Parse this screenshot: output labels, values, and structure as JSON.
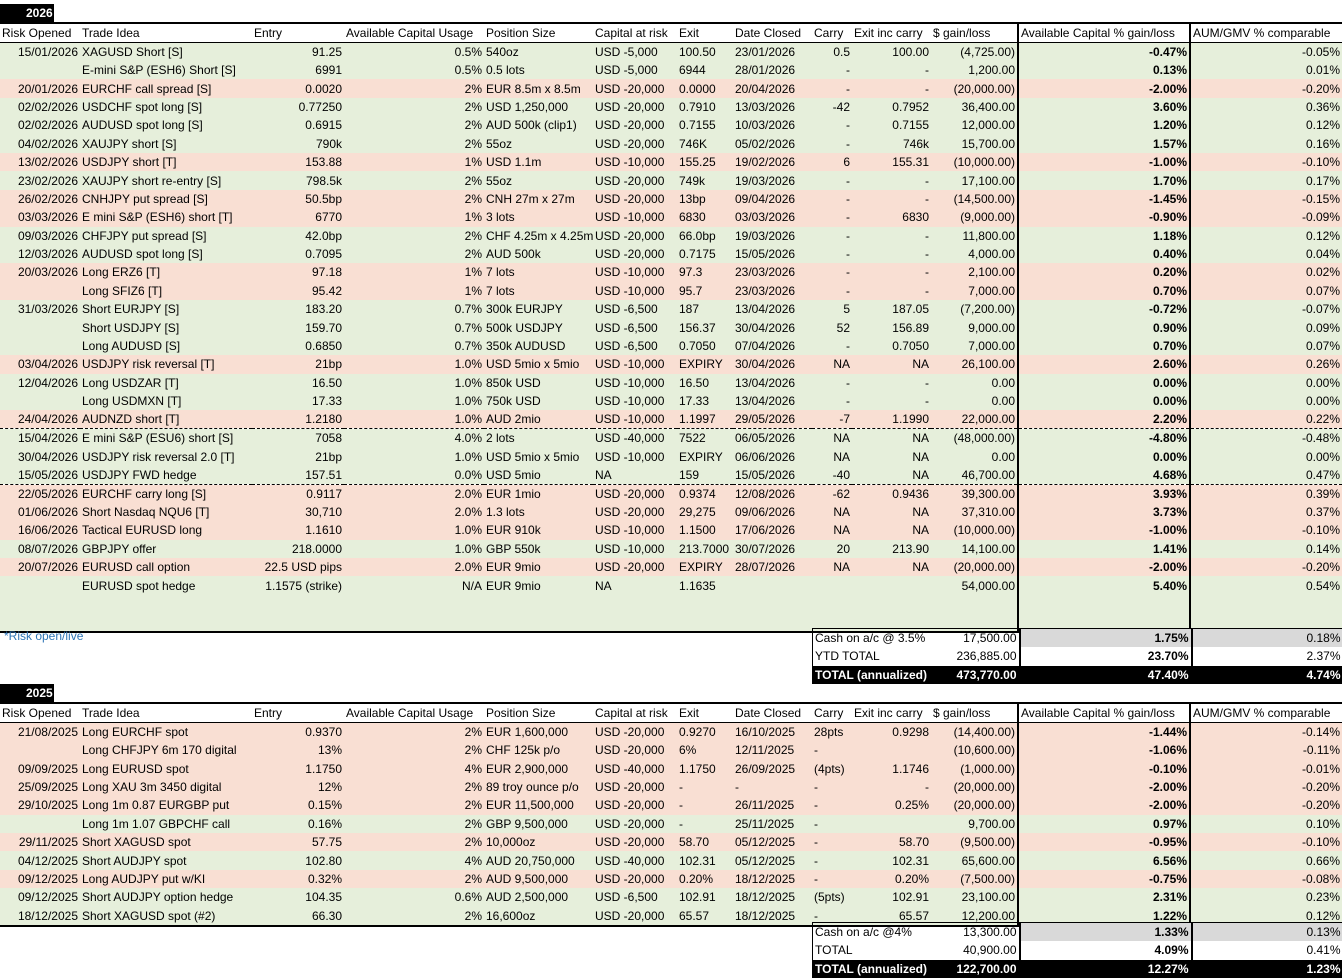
{
  "headers": [
    "Risk Opened",
    "Trade Idea",
    "Entry",
    "Available Capital Usage",
    "Position Size",
    "Capital at risk",
    "Exit",
    "Date Closed",
    "Carry",
    "Exit inc carry",
    "$ gain/loss",
    "Available Capital % gain/loss",
    "AUM/GMV % comparable"
  ],
  "y2026": {
    "label": "2026",
    "rows": [
      {
        "c": "g",
        "d": [
          "15/01/2026",
          "XAGUSD Short [S]",
          "91.25",
          "0.5%",
          "540oz",
          "USD -5,000",
          "100.50",
          "23/01/2026",
          "0.5",
          "100.00",
          "(4,725.00)",
          "-0.47%",
          "-0.05%"
        ]
      },
      {
        "c": "g",
        "d": [
          "",
          "E-mini S&P (ESH6) Short [S]",
          "6991",
          "0.5%",
          "0.5 lots",
          "USD -5,000",
          "6944",
          "28/01/2026",
          "-",
          "-",
          "1,200.00",
          "0.13%",
          "0.01%"
        ]
      },
      {
        "c": "r",
        "d": [
          "20/01/2026",
          "EURCHF call spread [S]",
          "0.0020",
          "2%",
          "EUR 8.5m x 8.5m",
          "USD -20,000",
          "0.0000",
          "20/04/2026",
          "-",
          "-",
          "(20,000.00)",
          "-2.00%",
          "-0.20%"
        ]
      },
      {
        "c": "g",
        "d": [
          "02/02/2026",
          "USDCHF spot long [S]",
          "0.77250",
          "2%",
          "USD 1,250,000",
          "USD -20,000",
          "0.7910",
          "13/03/2026",
          "-42",
          "0.7952",
          "36,400.00",
          "3.60%",
          "0.36%"
        ]
      },
      {
        "c": "g",
        "d": [
          "02/02/2026",
          "AUDUSD spot long [S]",
          "0.6915",
          "2%",
          "AUD 500k (clip1)",
          "USD -20,000",
          "0.7155",
          "10/03/2026",
          "-",
          "0.7155",
          "12,000.00",
          "1.20%",
          "0.12%"
        ]
      },
      {
        "c": "g",
        "d": [
          "04/02/2026",
          "XAUJPY short [S]",
          "790k",
          "2%",
          "55oz",
          "USD -20,000",
          "746K",
          "05/02/2026",
          "-",
          "746k",
          "15,700.00",
          "1.57%",
          "0.16%"
        ]
      },
      {
        "c": "r",
        "d": [
          "13/02/2026",
          "USDJPY short [T]",
          "153.88",
          "1%",
          "USD 1.1m",
          "USD -10,000",
          "155.25",
          "19/02/2026",
          "6",
          "155.31",
          "(10,000.00)",
          "-1.00%",
          "-0.10%"
        ]
      },
      {
        "c": "g",
        "d": [
          "23/02/2026",
          "XAUJPY short re-entry [S]",
          "798.5k",
          "2%",
          "55oz",
          "USD -20,000",
          "749k",
          "19/03/2026",
          "-",
          "-",
          "17,100.00",
          "1.70%",
          "0.17%"
        ]
      },
      {
        "c": "r",
        "d": [
          "26/02/2026",
          "CNHJPY put spread [S]",
          "50.5bp",
          "2%",
          "CNH 27m x 27m",
          "USD -20,000",
          "13bp",
          "09/04/2026",
          "-",
          "-",
          "(14,500.00)",
          "-1.45%",
          "-0.15%"
        ]
      },
      {
        "c": "r",
        "d": [
          "03/03/2026",
          "E mini S&P (ESH6) short [T]",
          "6770",
          "1%",
          "3 lots",
          "USD -10,000",
          "6830",
          "03/03/2026",
          "-",
          "6830",
          "(9,000.00)",
          "-0.90%",
          "-0.09%"
        ]
      },
      {
        "c": "g",
        "d": [
          "09/03/2026",
          "CHFJPY put spread [S]",
          "42.0bp",
          "2%",
          "CHF 4.25m x 4.25m",
          "USD -20,000",
          "66.0bp",
          "19/03/2026",
          "-",
          "-",
          "11,800.00",
          "1.18%",
          "0.12%"
        ]
      },
      {
        "c": "g",
        "d": [
          "12/03/2026",
          "AUDUSD spot long [S]",
          "0.7095",
          "2%",
          "AUD 500k",
          "USD -20,000",
          "0.7175",
          "15/05/2026",
          "-",
          "-",
          "4,000.00",
          "0.40%",
          "0.04%"
        ]
      },
      {
        "c": "r",
        "d": [
          "20/03/2026",
          "Long ERZ6 [T]",
          "97.18",
          "1%",
          "7 lots",
          "USD -10,000",
          "97.3",
          "23/03/2026",
          "-",
          "-",
          "2,100.00",
          "0.20%",
          "0.02%"
        ]
      },
      {
        "c": "r",
        "d": [
          "",
          "Long SFIZ6 [T]",
          "95.42",
          "1%",
          "7 lots",
          "USD -10,000",
          "95.7",
          "23/03/2026",
          "-",
          "-",
          "7,000.00",
          "0.70%",
          "0.07%"
        ]
      },
      {
        "c": "g",
        "d": [
          "31/03/2026",
          "Short EURJPY [S]",
          "183.20",
          "0.7%",
          "300k EURJPY",
          "USD -6,500",
          "187",
          "13/04/2026",
          "5",
          "187.05",
          "(7,200.00)",
          "-0.72%",
          "-0.07%"
        ]
      },
      {
        "c": "g",
        "d": [
          "",
          "Short USDJPY [S]",
          "159.70",
          "0.7%",
          "500k USDJPY",
          "USD -6,500",
          "156.37",
          "30/04/2026",
          "52",
          "156.89",
          "9,000.00",
          "0.90%",
          "0.09%"
        ]
      },
      {
        "c": "g",
        "d": [
          "",
          "Long AUDUSD [S]",
          "0.6850",
          "0.7%",
          "350k AUDUSD",
          "USD -6,500",
          "0.7050",
          "07/04/2026",
          "-",
          "0.7050",
          "7,000.00",
          "0.70%",
          "0.07%"
        ]
      },
      {
        "c": "r",
        "d": [
          "03/04/2026",
          "USDJPY risk reversal [T]",
          "21bp",
          "1.0%",
          "USD 5mio x 5mio",
          "USD -10,000",
          "EXPIRY",
          "30/04/2026",
          "NA",
          "NA",
          "26,100.00",
          "2.60%",
          "0.26%"
        ]
      },
      {
        "c": "g",
        "d": [
          "12/04/2026",
          "Long USDZAR [T]",
          "16.50",
          "1.0%",
          "850k USD",
          "USD -10,000",
          "16.50",
          "13/04/2026",
          "-",
          "-",
          "0.00",
          "0.00%",
          "0.00%"
        ]
      },
      {
        "c": "g",
        "d": [
          "",
          "Long USDMXN [T]",
          "17.33",
          "1.0%",
          "750k USD",
          "USD -10,000",
          "17.33",
          "13/04/2026",
          "-",
          "-",
          "0.00",
          "0.00%",
          "0.00%"
        ]
      },
      {
        "c": "r",
        "d": [
          "24/04/2026",
          "AUDNZD short [T]",
          "1.2180",
          "1.0%",
          "AUD 2mio",
          "USD -10,000",
          "1.1997",
          "29/05/2026",
          "-7",
          "1.1990",
          "22,000.00",
          "2.20%",
          "0.22%"
        ]
      },
      {
        "c": "g",
        "sep": true,
        "d": [
          "15/04/2026",
          "E mini S&P (ESU6) short [S]",
          "7058",
          "4.0%",
          "2 lots",
          "USD -40,000",
          "7522",
          "06/05/2026",
          "NA",
          "NA",
          "(48,000.00)",
          "-4.80%",
          "-0.48%"
        ]
      },
      {
        "c": "g",
        "d": [
          "30/04/2026",
          "USDJPY risk reversal 2.0 [T]",
          "21bp",
          "1.0%",
          "USD 5mio x 5mio",
          "USD -10,000",
          "EXPIRY",
          "06/06/2026",
          "NA",
          "NA",
          "0.00",
          "0.00%",
          "0.00%"
        ]
      },
      {
        "c": "g",
        "d": [
          "15/05/2026",
          "USDJPY FWD hedge",
          "157.51",
          "0.0%",
          "USD 5mio",
          "NA",
          "159",
          "15/05/2026",
          "-40",
          "NA",
          "46,700.00",
          "4.68%",
          "0.47%"
        ]
      },
      {
        "c": "r",
        "sep": true,
        "d": [
          "22/05/2026",
          "EURCHF carry long [S]",
          "0.9117",
          "2.0%",
          "EUR 1mio",
          "USD -20,000",
          "0.9374",
          "12/08/2026",
          "-62",
          "0.9436",
          "39,300.00",
          "3.93%",
          "0.39%"
        ]
      },
      {
        "c": "r",
        "d": [
          "01/06/2026",
          "Short Nasdaq NQU6 [T]",
          "30,710",
          "2.0%",
          "1.3 lots",
          "USD -20,000",
          "29,275",
          "09/06/2026",
          "NA",
          "NA",
          "37,310.00",
          "3.73%",
          "0.37%"
        ]
      },
      {
        "c": "r",
        "d": [
          "16/06/2026",
          "Tactical EURUSD long",
          "1.1610",
          "1.0%",
          "EUR 910k",
          "USD -10,000",
          "1.1500",
          "17/06/2026",
          "NA",
          "NA",
          "(10,000.00)",
          "-1.00%",
          "-0.10%"
        ]
      },
      {
        "c": "g",
        "d": [
          "08/07/2026",
          "GBPJPY offer",
          "218.0000",
          "1.0%",
          "GBP 550k",
          "USD -10,000",
          "213.7000",
          "30/07/2026",
          "20",
          "213.90",
          "14,100.00",
          "1.41%",
          "0.14%"
        ]
      },
      {
        "c": "r",
        "d": [
          "20/07/2026",
          "EURUSD call option",
          "22.5 USD pips",
          "2.0%",
          "EUR 9mio",
          "USD -20,000",
          "EXPIRY",
          "28/07/2026",
          "NA",
          "NA",
          "(20,000.00)",
          "-2.00%",
          "-0.20%"
        ]
      },
      {
        "c": "g",
        "d": [
          "",
          "EURUSD spot hedge",
          "1.1575 (strike)",
          "N/A",
          "EUR 9mio",
          "NA",
          "1.1635",
          "",
          "",
          "",
          "54,000.00",
          "5.40%",
          "0.54%"
        ]
      }
    ],
    "note": "*Risk open/live",
    "summary": [
      {
        "label": "Cash on a/c @ 3.5%",
        "value": "17,500.00",
        "pct": "1.75%",
        "aum": "0.18%",
        "style": "gray"
      },
      {
        "label": "YTD TOTAL",
        "value": "236,885.00",
        "pct": "23.70%",
        "aum": "2.37%",
        "style": "plain"
      },
      {
        "label": "TOTAL (annualized)",
        "value": "473,770.00",
        "pct": "47.40%",
        "aum": "4.74%",
        "style": "black"
      }
    ]
  },
  "y2025": {
    "label": "2025",
    "rows": [
      {
        "c": "r",
        "d": [
          "21/08/2025",
          "Long EURCHF spot",
          "0.9370",
          "2%",
          "EUR 1,600,000",
          "USD -20,000",
          "0.9270",
          "16/10/2025",
          "28pts",
          "0.9298",
          "(14,400.00)",
          "-1.44%",
          "-0.14%"
        ]
      },
      {
        "c": "r",
        "d": [
          "",
          "Long CHFJPY 6m 170 digital",
          "13%",
          "2%",
          "CHF 125k p/o",
          "USD -20,000",
          "6%",
          "12/11/2025",
          "-",
          "",
          "(10,600.00)",
          "-1.06%",
          "-0.11%"
        ]
      },
      {
        "c": "r",
        "d": [
          "09/09/2025",
          "Long EURUSD spot",
          "1.1750",
          "4%",
          "EUR 2,900,000",
          "USD -40,000",
          "1.1750",
          "26/09/2025",
          "(4pts)",
          "1.1746",
          "(1,000.00)",
          "-0.10%",
          "-0.01%"
        ]
      },
      {
        "c": "r",
        "d": [
          "25/09/2025",
          "Long XAU 3m 3450 digital",
          "12%",
          "2%",
          "89 troy ounce p/o",
          "USD -20,000",
          "-",
          "-",
          "-",
          "-",
          "(20,000.00)",
          "-2.00%",
          "-0.20%"
        ]
      },
      {
        "c": "r",
        "d": [
          "29/10/2025",
          "Long 1m 0.87 EURGBP put",
          "0.15%",
          "2%",
          "EUR 11,500,000",
          "USD -20,000",
          "-",
          "26/11/2025",
          "-",
          "0.25%",
          "(20,000.00)",
          "-2.00%",
          "-0.20%"
        ]
      },
      {
        "c": "g",
        "d": [
          "",
          "Long 1m 1.07 GBPCHF call",
          "0.16%",
          "2%",
          "GBP 9,500,000",
          "USD -20,000",
          "-",
          "25/11/2025",
          "-",
          "",
          "9,700.00",
          "0.97%",
          "0.10%"
        ]
      },
      {
        "c": "r",
        "d": [
          "29/11/2025",
          "Short XAGUSD spot",
          "57.75",
          "2%",
          "10,000oz",
          "USD -20,000",
          "58.70",
          "05/12/2025",
          "-",
          "58.70",
          "(9,500.00)",
          "-0.95%",
          "-0.10%"
        ]
      },
      {
        "c": "g",
        "d": [
          "04/12/2025",
          "Short AUDJPY spot",
          "102.80",
          "4%",
          "AUD 20,750,000",
          "USD -40,000",
          "102.31",
          "05/12/2025",
          "-",
          "102.31",
          "65,600.00",
          "6.56%",
          "0.66%"
        ]
      },
      {
        "c": "r",
        "d": [
          "09/12/2025",
          "Long AUDJPY put w/KI",
          "0.32%",
          "2%",
          "AUD 9,500,000",
          "USD -20,000",
          "0.20%",
          "18/12/2025",
          "-",
          "0.20%",
          "(7,500.00)",
          "-0.75%",
          "-0.08%"
        ]
      },
      {
        "c": "g",
        "d": [
          "09/12/2025",
          "Short AUDJPY option hedge",
          "104.35",
          "0.6%",
          "AUD 2,500,000",
          "USD  -6,500",
          "102.91",
          "18/12/2025",
          "(5pts)",
          "102.91",
          "23,100.00",
          "2.31%",
          "0.23%"
        ]
      },
      {
        "c": "g",
        "d": [
          "18/12/2025",
          "Short XAGUSD spot (#2)",
          "66.30",
          "2%",
          "16,600oz",
          "USD -20,000",
          "65.57",
          "18/12/2025",
          "-",
          "65.57",
          "12,200.00",
          "1.22%",
          "0.12%"
        ]
      }
    ],
    "summary": [
      {
        "label": "Cash on a/c @4%",
        "value": "13,300.00",
        "pct": "1.33%",
        "aum": "0.13%",
        "style": "gray"
      },
      {
        "label": "TOTAL",
        "value": "40,900.00",
        "pct": "4.09%",
        "aum": "0.41%",
        "style": "plain"
      },
      {
        "label": "TOTAL (annualized)",
        "value": "122,700.00",
        "pct": "12.27%",
        "aum": "1.23%",
        "style": "black"
      }
    ]
  },
  "colors": {
    "green": "#e6efdb",
    "red": "#f9dfd3",
    "black": "#000000",
    "gray": "#d9d9d9",
    "note": "#2e75b6"
  }
}
